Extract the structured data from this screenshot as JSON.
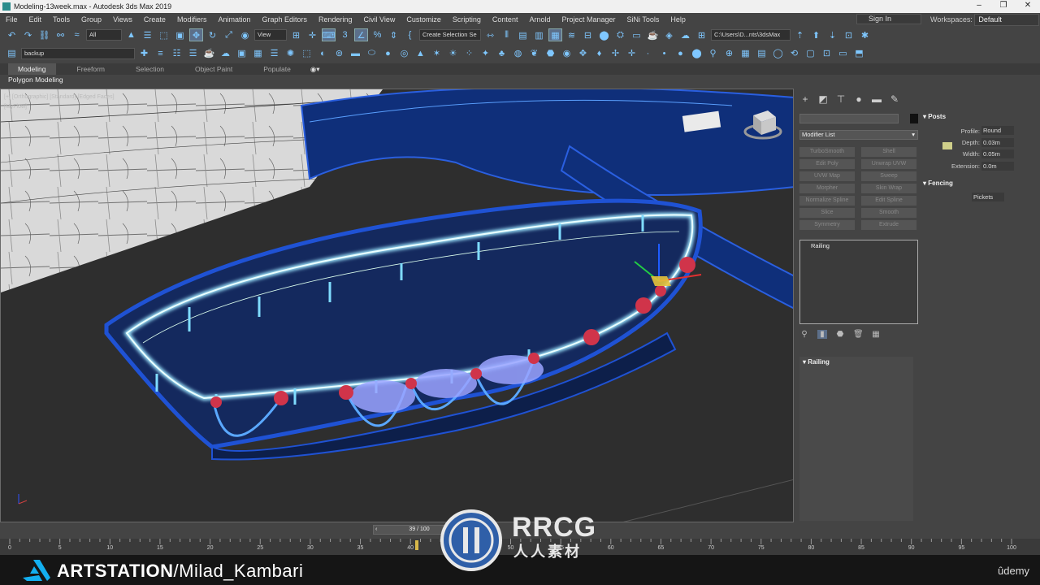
{
  "window": {
    "title": "Modeling-13week.max - Autodesk 3ds Max 2019"
  },
  "menubar": {
    "items": [
      "File",
      "Edit",
      "Tools",
      "Group",
      "Views",
      "Create",
      "Modifiers",
      "Animation",
      "Graph Editors",
      "Rendering",
      "Civil View",
      "Customize",
      "Scripting",
      "Content",
      "Arnold",
      "Project Manager",
      "SiNi Tools",
      "Help"
    ],
    "sign_in": "Sign In",
    "workspaces_label": "Workspaces:",
    "workspace_value": "Default"
  },
  "toolbar": {
    "selection_filter": "All",
    "view_dropdown": "View",
    "selection_set": "Create Selection Se",
    "path": "C:\\Users\\D...nts\\3dsMax",
    "layer": "backup"
  },
  "ribbon": {
    "tabs": [
      "Modeling",
      "Freeform",
      "Selection",
      "Object Paint",
      "Populate"
    ],
    "sub_label": "Polygon Modeling"
  },
  "viewport": {
    "label": "[+] [Orthographic] [Standard] [Edged Faces]",
    "label2": "[MyFlow]"
  },
  "command_panel": {
    "modifier_list": "Modifier List",
    "modifier_buttons": [
      "TurboSmooth",
      "Shell",
      "Edit Poly",
      "Unwrap UVW",
      "UVW Map",
      "Sweep",
      "Morpher",
      "Skin Wrap",
      "Normalize Spline",
      "Edit Spline",
      "Slice",
      "Smooth",
      "Symmetry",
      "Extrude"
    ],
    "stack_entry": "Railing",
    "rollout_railing": "Railing",
    "posts": {
      "title": "Posts",
      "profile_label": "Profile:",
      "profile_value": "Round",
      "depth_label": "Depth:",
      "depth_value": "0.03m",
      "width_label": "Width:",
      "width_value": "0.05m",
      "extension_label": "Extension:",
      "extension_value": "0.0m"
    },
    "fencing": {
      "title": "Fencing",
      "value": "Pickets"
    }
  },
  "timeline": {
    "frame": "39 / 100",
    "ticks": [
      "0",
      "5",
      "10",
      "15",
      "20",
      "25",
      "30",
      "35",
      "40",
      "45",
      "50",
      "55",
      "60",
      "65",
      "70",
      "75",
      "80",
      "85",
      "90",
      "95",
      "100"
    ]
  },
  "footer": {
    "brand_prefix": "ARTSTATION",
    "brand_suffix": "/Milad_Kambari",
    "udemy": "ûdemy"
  },
  "watermark": {
    "text": "RRCG",
    "sub": "人人素材"
  }
}
